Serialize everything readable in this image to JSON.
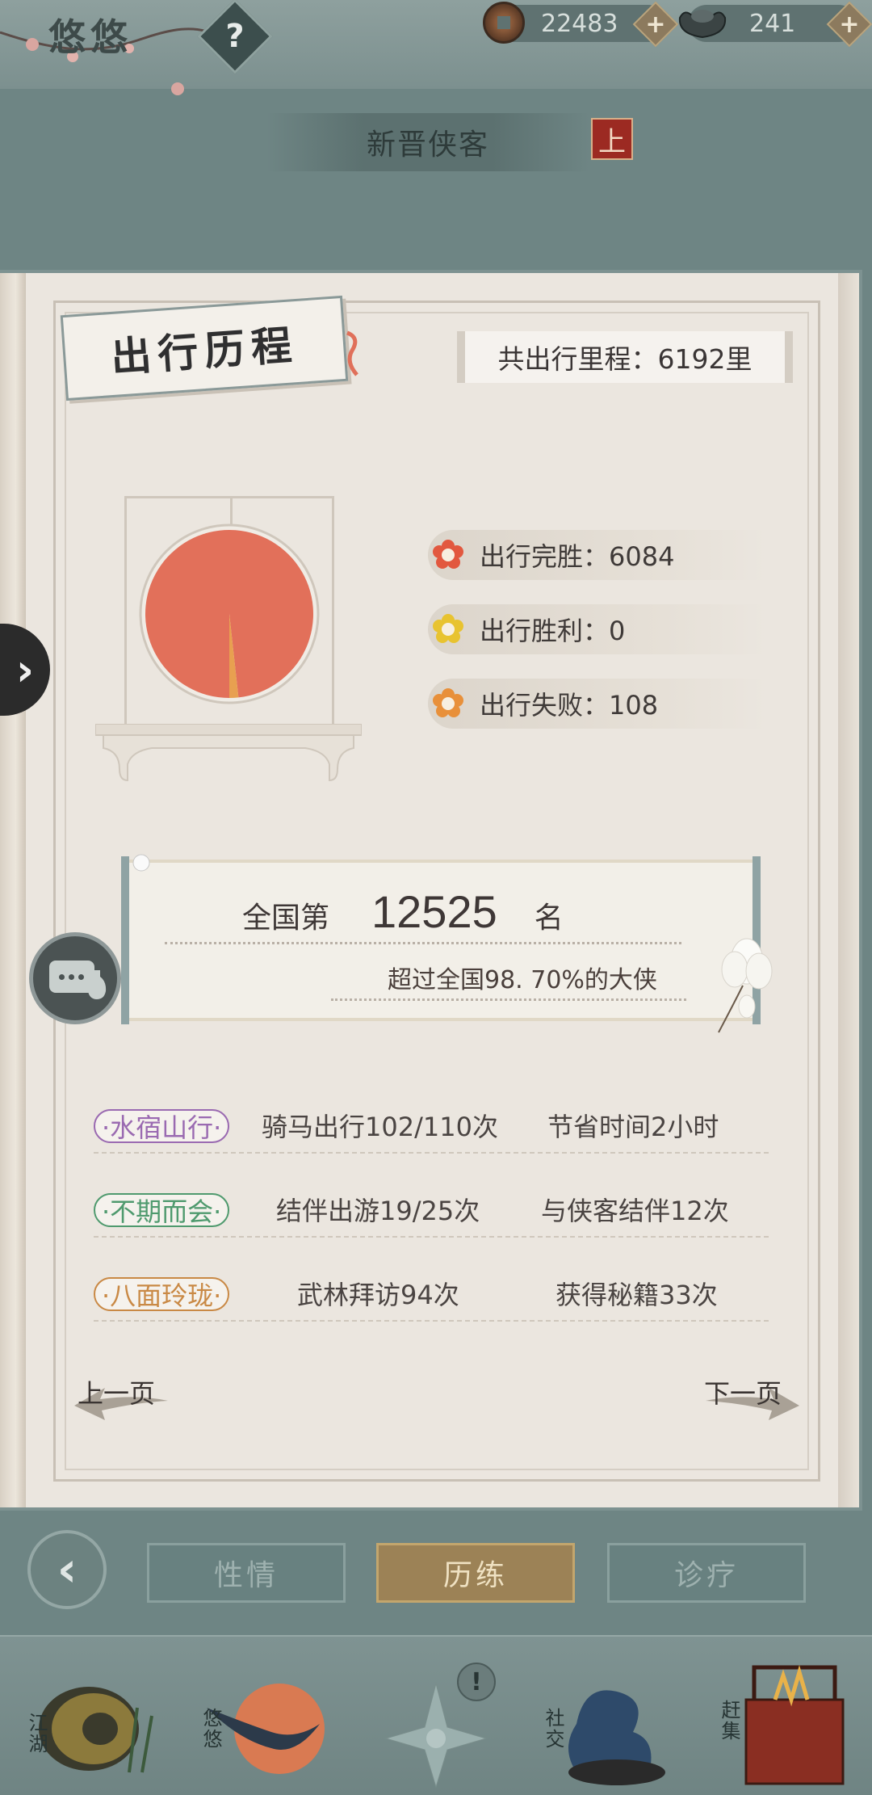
{
  "header": {
    "app_title": "悠悠",
    "help_label": "?",
    "copper_amount": "22483",
    "silver_amount": "241",
    "plus_label": "+",
    "icons": [
      "coin-icon",
      "silver-ingot-icon",
      "plus-icon",
      "question-icon"
    ]
  },
  "subtitle": {
    "text": "新晋侠客",
    "badge": "上"
  },
  "page": {
    "section_title": "出行历程",
    "total_distance": "共出行里程：6192里",
    "stats": [
      {
        "label": "出行完胜：6084",
        "color": "#e2583f"
      },
      {
        "label": "出行胜利：0",
        "color": "#e8c330"
      },
      {
        "label": "出行失败：108",
        "color": "#e8903a"
      }
    ],
    "rank": {
      "prefix": "全国第",
      "number": "12525",
      "suffix": "名",
      "exceed_text": "超过全国98. 70%的大侠"
    },
    "activities": [
      {
        "tag": "·水宿山行·",
        "text1": "骑马出行102/110次",
        "text2": "节省时间2小时",
        "color": "#9a6ab1"
      },
      {
        "tag": "·不期而会·",
        "text1": "结伴出游19/25次",
        "text2": "与侠客结伴12次",
        "color": "#4f9a6e"
      },
      {
        "tag": "·八面玲珑·",
        "text1": "武林拜访94次",
        "text2": "获得秘籍33次",
        "color": "#c98945"
      }
    ],
    "prev_page": "上一页",
    "next_page": "下一页"
  },
  "chart_data": {
    "type": "pie",
    "categories": [
      "出行完胜",
      "出行胜利",
      "出行失败"
    ],
    "values": [
      6084,
      0,
      108
    ],
    "colors": [
      "#e2705a",
      "#e8c330",
      "#e8a050"
    ]
  },
  "tabs": {
    "back_label": "‹",
    "items": [
      "性情",
      "历练",
      "诊疗"
    ],
    "active_index": 1
  },
  "bottom_nav": {
    "items": [
      "江湖",
      "悠悠",
      "",
      "社交",
      "赶集"
    ],
    "alert": "!"
  },
  "colors": {
    "background": "#6e8584",
    "paper": "#ebe6df",
    "pie_main": "#e2705a",
    "active_tab": "#9c8256"
  }
}
